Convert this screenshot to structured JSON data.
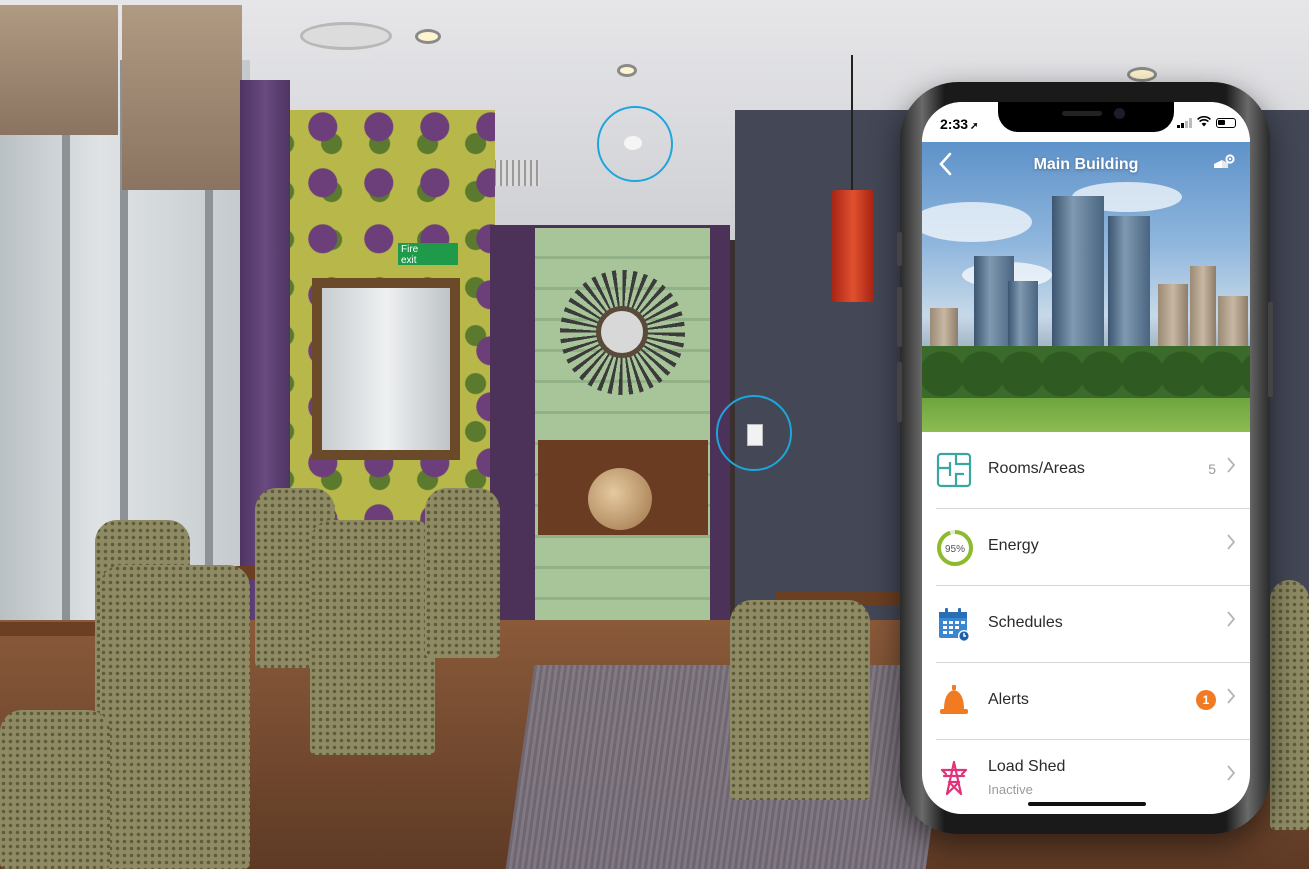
{
  "scene": {
    "exit_sign_line1": "Fire",
    "exit_sign_line2": "exit",
    "accent_ring_color": "#1ea6dc"
  },
  "status_bar": {
    "time": "2:33",
    "location_icon": "location-arrow-icon",
    "signal_icon": "cellular-signal-icon",
    "wifi_icon": "wifi-icon",
    "battery_icon": "battery-icon"
  },
  "header": {
    "back_icon": "chevron-left-icon",
    "title": "Main Building",
    "settings_icon": "building-settings-icon"
  },
  "menu": {
    "items": [
      {
        "label": "Rooms/Areas",
        "count": "5",
        "icon": "floorplan-icon",
        "icon_color": "#3aa6a0"
      },
      {
        "label": "Energy",
        "icon": "energy-gauge-icon",
        "gauge_text": "95%",
        "gauge_percent": 95,
        "icon_color": "#8dbb2e"
      },
      {
        "label": "Schedules",
        "icon": "calendar-icon",
        "icon_color": "#3b86d1"
      },
      {
        "label": "Alerts",
        "icon": "bell-icon",
        "badge": "1",
        "icon_color": "#f07b22",
        "badge_color": "#f07b22"
      },
      {
        "label": "Load Shed",
        "sublabel": "Inactive",
        "icon": "power-tower-icon",
        "icon_color": "#e0337a"
      }
    ],
    "chevron_icon": "chevron-right-icon"
  }
}
